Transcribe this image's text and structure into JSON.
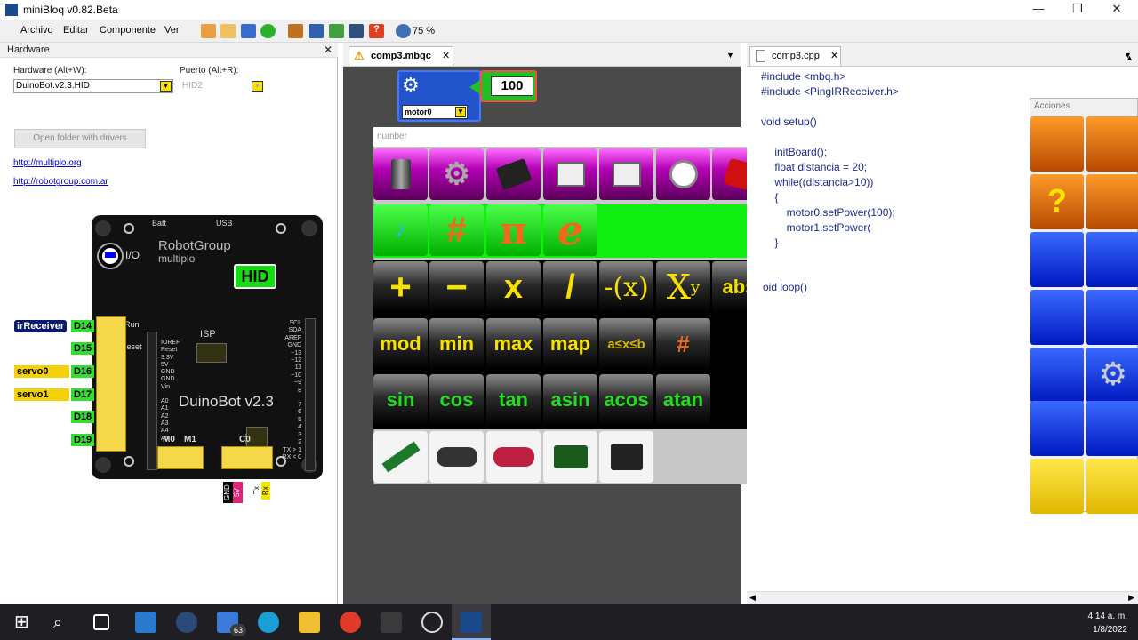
{
  "window": {
    "title": "miniBloq v0.82.Beta",
    "minimize": "—",
    "restore": "❐",
    "close": "✕"
  },
  "menu": [
    "Archivo",
    "Editar",
    "Componente",
    "Ver"
  ],
  "toolbar": {
    "zoom": "75 %"
  },
  "hardware": {
    "panel_title": "Hardware",
    "close": "✕",
    "hardware_label": "Hardware (Alt+W):",
    "hardware_value": "DuinoBot.v2.3.HID",
    "port_label": "Puerto (Alt+R):",
    "port_value": "HID2",
    "open_folder": "Open folder with drivers",
    "links": [
      "http://multiplo.org",
      "http://robotgroup.com.ar"
    ]
  },
  "board": {
    "batt": "Batt",
    "usb": "USB",
    "brand1": "RobotGroup",
    "brand2": "multiplo",
    "io": "I/O",
    "hid": "HID",
    "run": "Run",
    "reset": "Reset",
    "isp": "ISP",
    "name": "DuinoBot v2.3",
    "m0": "M0",
    "m1": "M1",
    "c0": "C0",
    "left_pins": [
      "IOREF",
      "Reset",
      "3.3V",
      "5V",
      "GND",
      "GND",
      "Vin",
      "",
      "A0",
      "A1",
      "A2",
      "A3",
      "A4",
      "A5"
    ],
    "right_pins": [
      "SCL",
      "SDA",
      "AREF",
      "GND",
      "~13",
      "~12",
      "11",
      "~10",
      "~9",
      "8",
      "",
      "7",
      "6",
      "5",
      "4",
      "3",
      "2",
      "TX > 1",
      "RX < 0"
    ],
    "bottom_pins": [
      "GND",
      "5V",
      "Tx",
      "Rx"
    ]
  },
  "pins": [
    {
      "component": "irReceiver",
      "pin": "D14"
    },
    {
      "component": "",
      "pin": "D15"
    },
    {
      "component": "servo0",
      "pin": "D16"
    },
    {
      "component": "servo1",
      "pin": "D17"
    },
    {
      "component": "",
      "pin": "D18"
    },
    {
      "component": "",
      "pin": "D19"
    }
  ],
  "editor": {
    "tab": "comp3.mbqc",
    "motor_label": "motor0",
    "number_value": "100"
  },
  "palette": {
    "search_placeholder": "number",
    "ops_row": [
      "+",
      "−",
      "x",
      "/",
      "-(x)",
      "X",
      "abs"
    ],
    "pow_sup": "y",
    "func_row": [
      "mod",
      "min",
      "max",
      "map",
      "a≤x≤b",
      "#"
    ],
    "trig_row": [
      "sin",
      "cos",
      "tan",
      "asin",
      "acos",
      "atan"
    ],
    "const_row": [
      "#",
      "π",
      "e"
    ]
  },
  "code": {
    "tab": "comp3.cpp",
    "lines": [
      "#include <mbq.h>",
      "#include <PingIRReceiver.h>",
      "",
      "void setup()",
      "",
      "    initBoard();",
      "    float distancia = 20;",
      "    while((distancia>10))",
      "    {",
      "        motor0.setPower(100);",
      "        motor1.setPower(",
      "    }",
      "",
      "",
      "oid loop()"
    ]
  },
  "acciones": {
    "title": "Acciones"
  },
  "taskbar": {
    "badge": "63",
    "time": "4:14 a. m.",
    "date": "1/8/2022"
  }
}
